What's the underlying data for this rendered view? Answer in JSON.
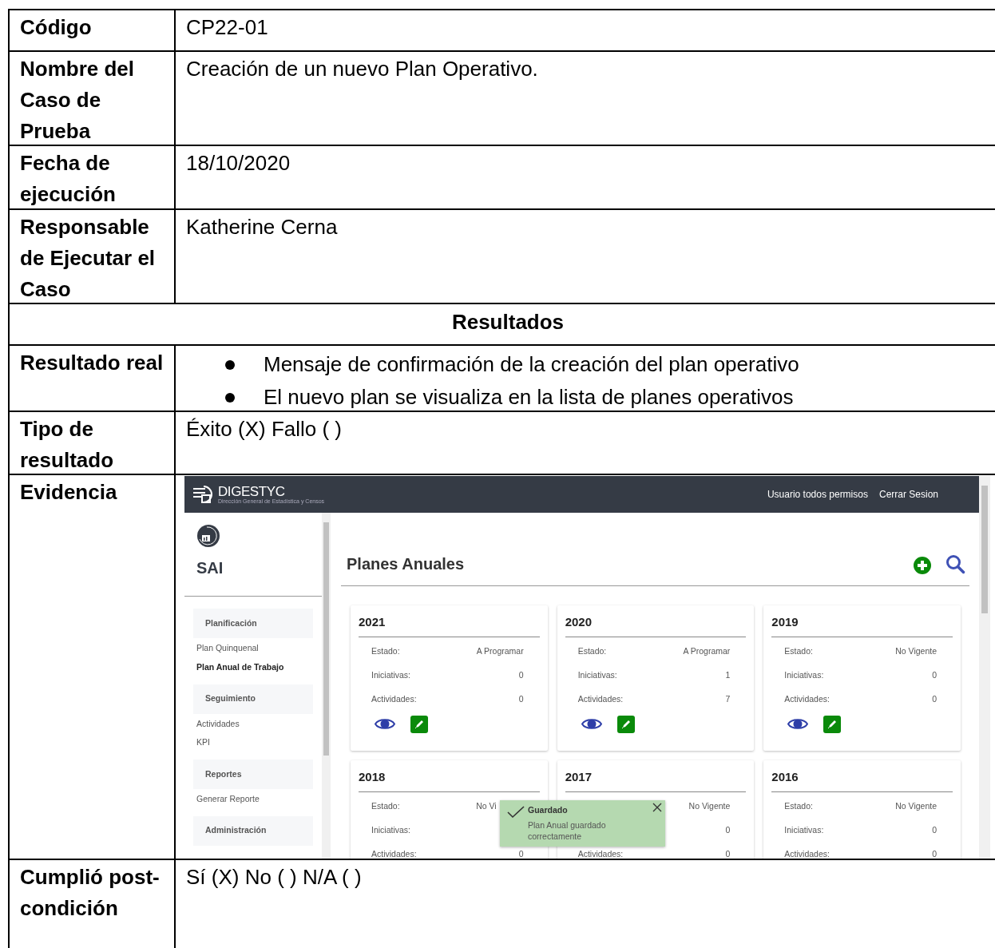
{
  "rows": [
    {
      "kind": "field",
      "label": "Código",
      "value": "CP22-01"
    },
    {
      "kind": "field",
      "label": "Nombre del Caso de Prueba",
      "value": "Creación de un nuevo Plan Operativo."
    },
    {
      "kind": "field",
      "label": "Fecha de ejecución",
      "value": "18/10/2020"
    },
    {
      "kind": "field",
      "label": "Responsable de Ejecutar el Caso",
      "value": "Katherine Cerna"
    },
    {
      "kind": "heading",
      "label": "Resultados"
    },
    {
      "kind": "bullets",
      "label": "Resultado real",
      "items": [
        "Mensaje de confirmación de la creación del plan operativo",
        "El nuevo plan se visualiza en la lista de planes operativos"
      ]
    },
    {
      "kind": "field",
      "label": "Tipo de resultado",
      "value": "Éxito (X) Fallo ( )"
    },
    {
      "kind": "evidence",
      "label": "Evidencia"
    },
    {
      "kind": "field",
      "label": "Cumplió post- condición",
      "value": "Sí (X) No ( )  N/A ( )"
    }
  ],
  "evidence": {
    "logo": {
      "name": "DIGESTYC",
      "subtitle": "Dirección General de Estadística y Censos"
    },
    "user": "Usuario todos permisos",
    "logout": "Cerrar Sesion",
    "brand": "SAI",
    "sidebar": [
      {
        "section": "Planificación",
        "items": [
          {
            "label": "Plan Quinquenal",
            "selected": false
          },
          {
            "label": "Plan Anual de Trabajo",
            "selected": true
          }
        ]
      },
      {
        "section": "Seguimiento",
        "items": [
          {
            "label": "Actividades",
            "selected": false
          },
          {
            "label": "KPI",
            "selected": false
          }
        ]
      },
      {
        "section": "Reportes",
        "items": [
          {
            "label": "Generar Reporte",
            "selected": false
          }
        ]
      },
      {
        "section": "Administración"
      }
    ],
    "title": "Planes Anuales",
    "cards": [
      {
        "year": "2021",
        "rows": [
          {
            "label": "Estado:",
            "value": "A Programar"
          },
          {
            "label": "Iniciativas:",
            "value": "0"
          },
          {
            "label": "Actividades:",
            "value": "0"
          }
        ]
      },
      {
        "year": "2020",
        "rows": [
          {
            "label": "Estado:",
            "value": "A Programar"
          },
          {
            "label": "Iniciativas:",
            "value": "1"
          },
          {
            "label": "Actividades:",
            "value": "7"
          }
        ]
      },
      {
        "year": "2019",
        "rows": [
          {
            "label": "Estado:",
            "value": "No Vigente"
          },
          {
            "label": "Iniciativas:",
            "value": "0"
          },
          {
            "label": "Actividades:",
            "value": "0"
          }
        ]
      },
      {
        "year": "2018",
        "rows": [
          {
            "label": "Estado:",
            "value": "No Vi",
            "cut": true
          },
          {
            "label": "Iniciativas:"
          },
          {
            "label": "Actividades:",
            "value": "0"
          }
        ]
      },
      {
        "year": "2017",
        "rows": [
          {
            "value": "No Vigente"
          },
          {
            "value": "0"
          },
          {
            "label": "Actividades:",
            "value": "0"
          }
        ]
      },
      {
        "year": "2016",
        "rows": [
          {
            "label": "Estado:",
            "value": "No Vigente"
          },
          {
            "label": "Iniciativas:",
            "value": "0"
          },
          {
            "label": "Actividades:",
            "value": "0"
          }
        ]
      }
    ],
    "toast": {
      "title": "Guardado",
      "message": "Plan Anual guardado correctamente"
    }
  }
}
